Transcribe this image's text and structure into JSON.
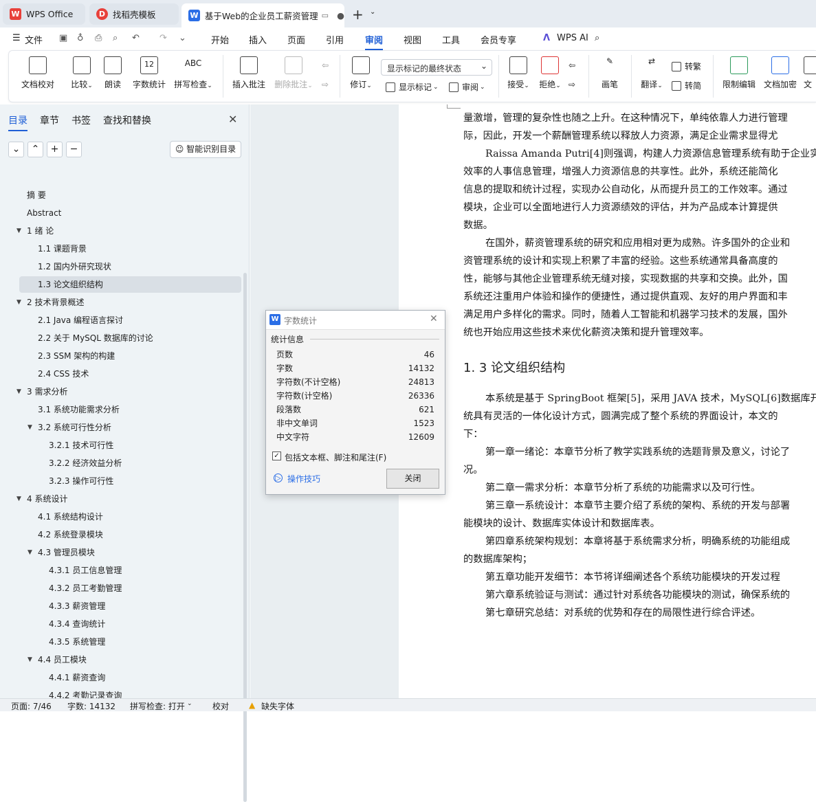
{
  "tabs": [
    {
      "label": "WPS Office",
      "logo": "W"
    },
    {
      "label": "找稻壳模板",
      "logo": "D"
    },
    {
      "label": "基于Web的企业员工薪资管理",
      "logo": "W"
    }
  ],
  "menu": {
    "file": "文件",
    "items": [
      "开始",
      "插入",
      "页面",
      "引用",
      "审阅",
      "视图",
      "工具",
      "会员专享"
    ],
    "active": "审阅",
    "ai": "WPS AI"
  },
  "ribbon": {
    "doc_check": "文档校对",
    "compare": "比较",
    "read": "朗读",
    "word_count": "字数统计",
    "spell": "拼写检查",
    "spell_top": "ABC",
    "wc_top": "12",
    "insert_comment": "插入批注",
    "delete_comment": "删除批注",
    "markup_select": "显示标记的最终状态",
    "track": "修订",
    "show_markup": "显示标记",
    "review": "审阅",
    "accept": "接受",
    "reject": "拒绝",
    "pen": "画笔",
    "translate": "翻译",
    "to_trad": "转繁",
    "to_simp": "转简",
    "restrict": "限制编辑",
    "encrypt": "文档加密"
  },
  "panel": {
    "tabs": [
      "目录",
      "章节",
      "书签",
      "查找和替换"
    ],
    "smart_btn": "智能识别目录",
    "toc": [
      {
        "label": "摘  要",
        "level": 0,
        "arrow": false
      },
      {
        "label": "Abstract",
        "level": 0,
        "arrow": false
      },
      {
        "label": "1  绪  论",
        "level": 0,
        "arrow": true
      },
      {
        "label": "1.1 课题背景",
        "level": 1,
        "arrow": false
      },
      {
        "label": "1.2 国内外研究现状",
        "level": 1,
        "arrow": false
      },
      {
        "label": "1.3 论文组织结构",
        "level": 1,
        "arrow": false,
        "selected": true
      },
      {
        "label": "2  技术背景概述",
        "level": 0,
        "arrow": true
      },
      {
        "label": "2.1 Java 编程语言探讨",
        "level": 1,
        "arrow": false
      },
      {
        "label": "2.2  关于 MySQL 数据库的讨论",
        "level": 1,
        "arrow": false
      },
      {
        "label": "2.3 SSM 架构的构建",
        "level": 1,
        "arrow": false
      },
      {
        "label": "2.4 CSS 技术",
        "level": 1,
        "arrow": false
      },
      {
        "label": "3 需求分析",
        "level": 0,
        "arrow": true
      },
      {
        "label": "3.1  系统功能需求分析",
        "level": 1,
        "arrow": false
      },
      {
        "label": "3.2  系统可行性分析",
        "level": 1,
        "arrow": true
      },
      {
        "label": "3.2.1 技术可行性",
        "level": 2,
        "arrow": false
      },
      {
        "label": "3.2.2  经济效益分析",
        "level": 2,
        "arrow": false
      },
      {
        "label": "3.2.3 操作可行性",
        "level": 2,
        "arrow": false
      },
      {
        "label": "4 系统设计",
        "level": 0,
        "arrow": true
      },
      {
        "label": "4.1  系统结构设计",
        "level": 1,
        "arrow": false
      },
      {
        "label": "4.2  系统登录模块",
        "level": 1,
        "arrow": false
      },
      {
        "label": "4.3  管理员模块",
        "level": 1,
        "arrow": true
      },
      {
        "label": "4.3.1  员工信息管理",
        "level": 2,
        "arrow": false
      },
      {
        "label": "4.3.2  员工考勤管理",
        "level": 2,
        "arrow": false
      },
      {
        "label": "4.3.3  薪资管理",
        "level": 2,
        "arrow": false
      },
      {
        "label": "4.3.4  查询统计",
        "level": 2,
        "arrow": false
      },
      {
        "label": "4.3.5  系统管理",
        "level": 2,
        "arrow": false
      },
      {
        "label": "4.4  员工模块",
        "level": 1,
        "arrow": true
      },
      {
        "label": "4.4.1  薪资查询",
        "level": 2,
        "arrow": false
      },
      {
        "label": "4.4.2  考勤记录查询",
        "level": 2,
        "arrow": false
      }
    ]
  },
  "doc": {
    "lines": [
      "量激增，管理的复杂性也随之上升。在这种情况下，单纯依靠人力进行管理",
      "际，因此，开发一个薪酬管理系统以释放人力资源，满足企业需求显得尤",
      "Raissa Amanda Putri[4]则强调，构建人力资源信息管理系统有助于企业实",
      "效率的人事信息管理，增强人力资源信息的共享性。此外，系统还能简化",
      "信息的提取和统计过程，实现办公自动化，从而提升员工的工作效率。通过",
      "模块，企业可以全面地进行人力资源绩效的评估，并为产品成本计算提供",
      "数据。",
      "在国外，薪资管理系统的研究和应用相对更为成熟。许多国外的企业和",
      "资管理系统的设计和实现上积累了丰富的经验。这些系统通常具备高度的",
      "性，能够与其他企业管理系统无缝对接，实现数据的共享和交换。此外，国",
      "系统还注重用户体验和操作的便捷性，通过提供直观、友好的用户界面和丰",
      "满足用户多样化的需求。同时，随着人工智能和机器学习技术的发展，国外",
      "统也开始应用这些技术来优化薪资决策和提升管理效率。"
    ],
    "heading": "1. 3 论文组织结构",
    "lines2": [
      "本系统是基于 SpringBoot 框架[5]，采用 JAVA 技术，MySQL[6]数据库开",
      "统具有灵活的一体化设计方式，圆满完成了整个系统的界面设计，本文的",
      "下：",
      "第一章一绪论：本章节分析了教学实践系统的选题背景及意义，讨论了",
      "况。",
      "第二章一需求分析：本章节分析了系统的功能需求以及可行性。",
      "第三章一系统设计：本章节主要介绍了系统的架构、系统的开发与部署",
      "能模块的设计、数据库实体设计和数据库表。",
      "第四章系统架构规划：本章将基于系统需求分析，明确系统的功能组成",
      "的数据库架构；",
      "第五章功能开发细节：本节将详细阐述各个系统功能模块的开发过程",
      "第六章系统验证与测试：通过针对系统各功能模块的测试，确保系统的",
      "第七章研究总结：对系统的优势和存在的局限性进行综合评述。"
    ]
  },
  "dialog": {
    "title": "字数统计",
    "group": "统计信息",
    "rows": [
      {
        "k": "页数",
        "v": "46"
      },
      {
        "k": "字数",
        "v": "14132"
      },
      {
        "k": "字符数(不计空格)",
        "v": "24813"
      },
      {
        "k": "字符数(计空格)",
        "v": "26336"
      },
      {
        "k": "段落数",
        "v": "621"
      },
      {
        "k": "非中文单词",
        "v": "1523"
      },
      {
        "k": "中文字符",
        "v": "12609"
      }
    ],
    "checkbox": "包括文本框、脚注和尾注(F)",
    "tips": "操作技巧",
    "close": "关闭"
  },
  "status": {
    "page": "页面: 7/46",
    "words": "字数: 14132",
    "spell": "拼写检查: 打开",
    "proof": "校对",
    "font": "缺失字体"
  },
  "colors": {
    "accent": "#1f5fd6",
    "wps_red": "#e8403a"
  }
}
